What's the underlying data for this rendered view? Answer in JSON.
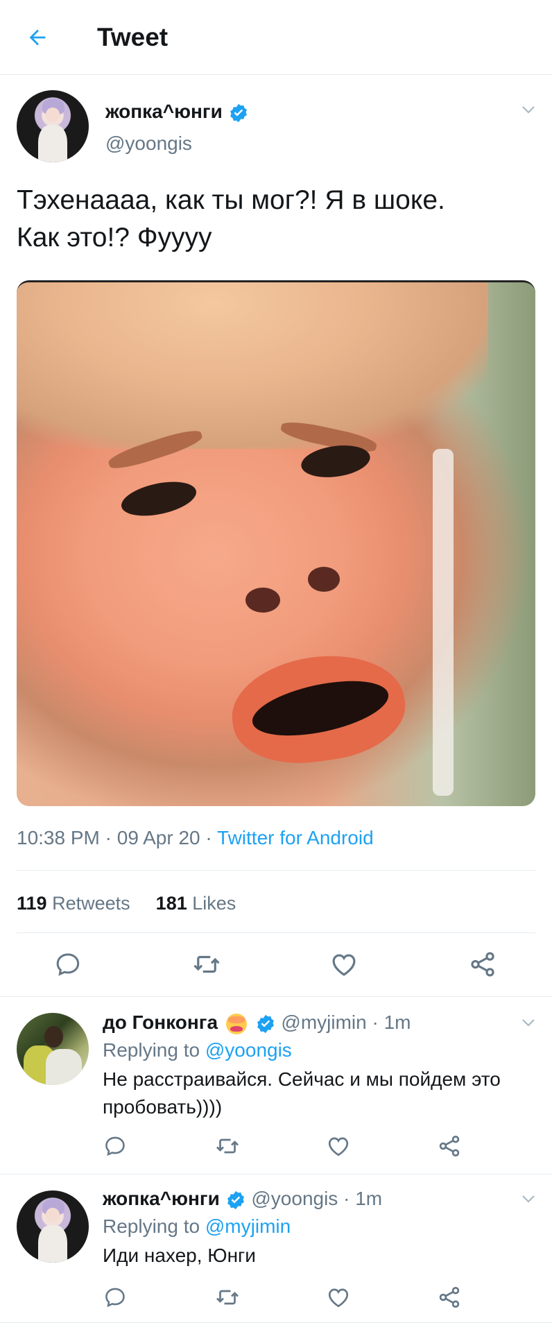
{
  "header": {
    "title": "Tweet"
  },
  "main_tweet": {
    "display_name": "жопка^юнги",
    "handle": "@yoongis",
    "text_line1": "Тэхенаааа, как ты мог?! Я в шоке.",
    "text_line2": "Как это!? Фуууу",
    "time": "10:38 PM",
    "date": "09 Apr 20",
    "source": "Twitter for Android",
    "retweets_count": "119",
    "retweets_label": "Retweets",
    "likes_count": "181",
    "likes_label": "Likes"
  },
  "replies": [
    {
      "display_name": "до Гонконга",
      "emoji": "hot-face-emoji",
      "handle": "@myjimin",
      "time": "1m",
      "replying_label": "Replying to",
      "replying_to": "@yoongis",
      "text": "Не расстраивайся. Сейчас и мы пойдем это пробовать))))"
    },
    {
      "display_name": "жопка^юнги",
      "handle": "@yoongis",
      "time": "1m",
      "replying_label": "Replying to",
      "replying_to": "@myjimin",
      "text": "Иди нахер, Юнги"
    }
  ],
  "separator": "·",
  "colors": {
    "accent": "#1da1f2",
    "muted": "#657786",
    "text": "#14171a",
    "border": "#e6ecf0"
  },
  "icons": [
    "back-arrow-icon",
    "verified-badge-icon",
    "chevron-down-icon",
    "reply-icon",
    "retweet-icon",
    "like-icon",
    "share-icon"
  ]
}
